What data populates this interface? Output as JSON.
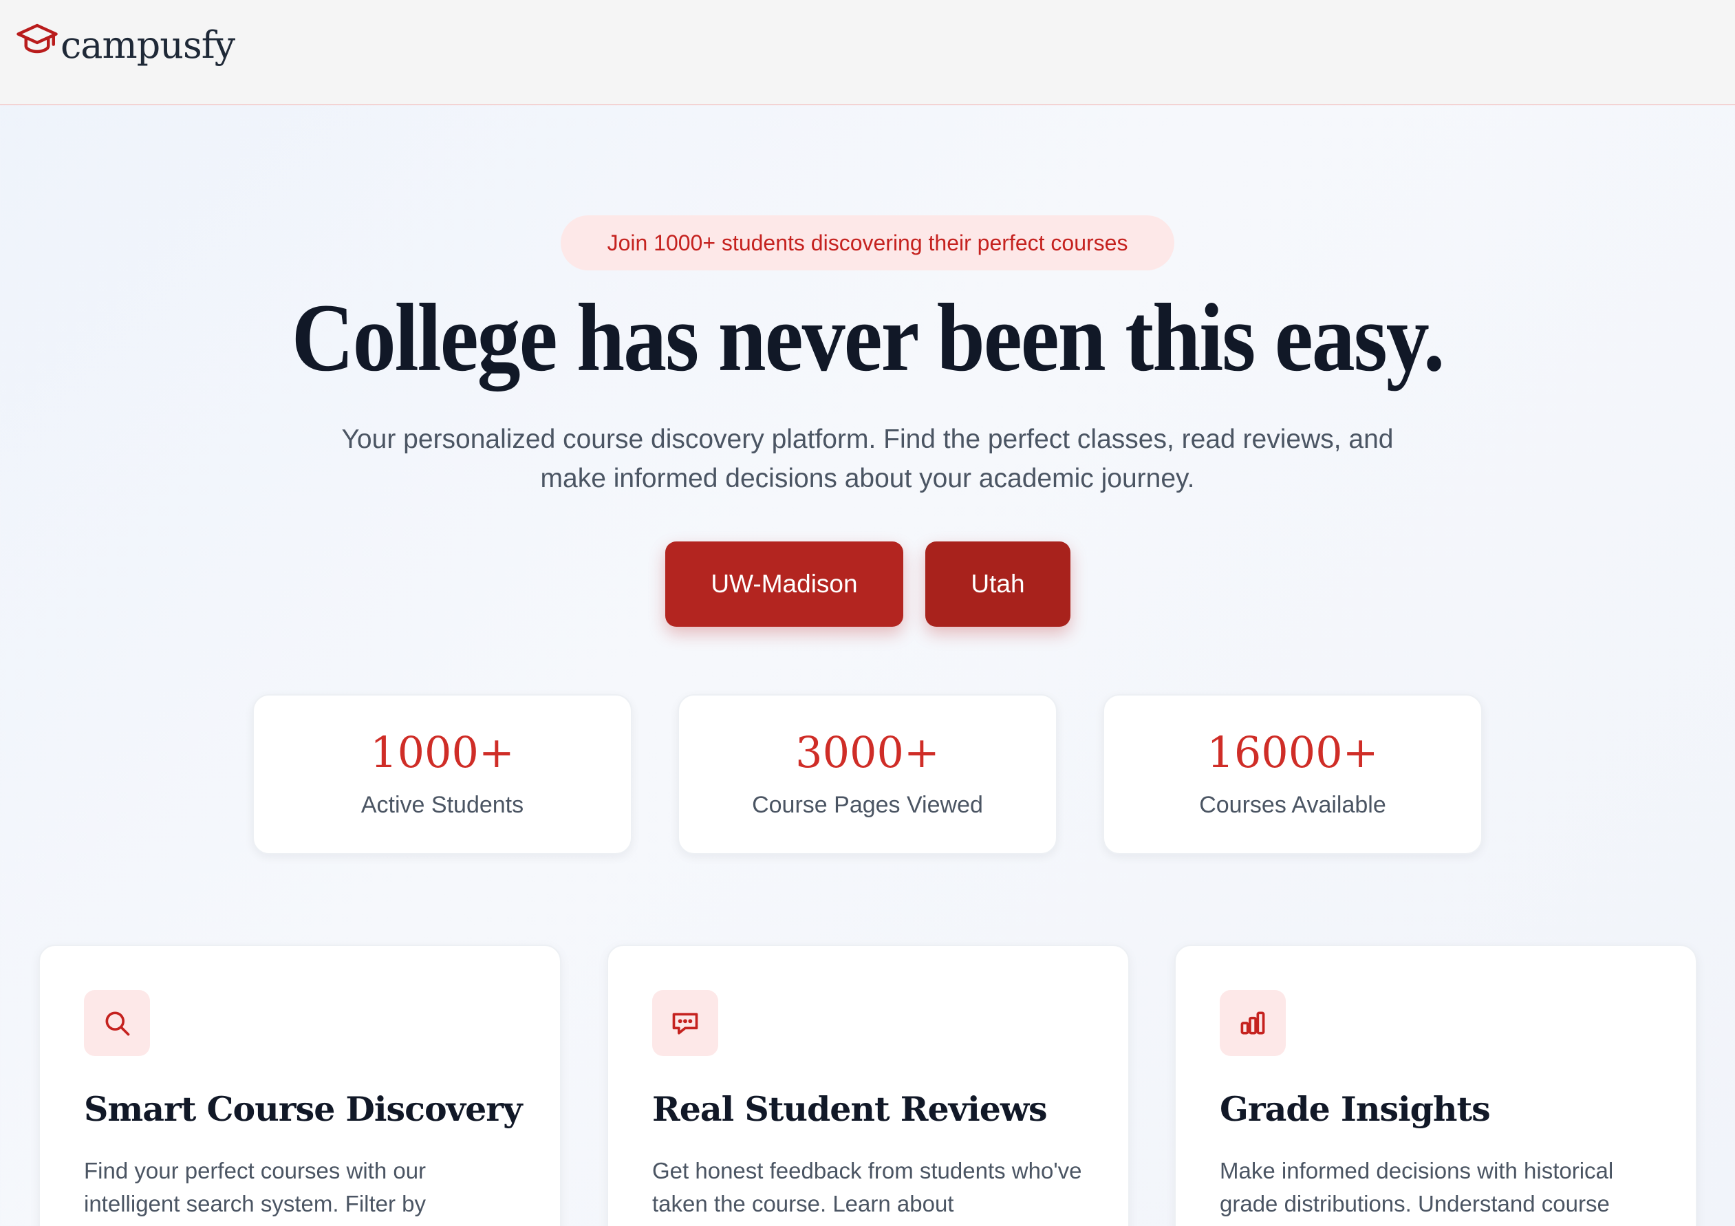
{
  "brand": {
    "name": "campusfy",
    "icon": "graduation-cap-icon",
    "accent_color": "#b91c1c"
  },
  "hero": {
    "badge": "Join 1000+ students discovering their perfect courses",
    "title": "College has never been this easy.",
    "subtitle": "Your personalized course discovery platform. Find the perfect classes, read reviews, and make informed decisions about your academic journey.",
    "buttons": [
      {
        "label": "UW-Madison"
      },
      {
        "label": "Utah"
      }
    ]
  },
  "stats": [
    {
      "value": "1000+",
      "label": "Active Students"
    },
    {
      "value": "3000+",
      "label": "Course Pages Viewed"
    },
    {
      "value": "16000+",
      "label": "Courses Available"
    }
  ],
  "features": [
    {
      "icon": "search-icon",
      "title": "Smart Course Discovery",
      "description": "Find your perfect courses with our intelligent search system. Filter by"
    },
    {
      "icon": "chat-bubble-icon",
      "title": "Real Student Reviews",
      "description": "Get honest feedback from students who've taken the course. Learn about"
    },
    {
      "icon": "bar-chart-icon",
      "title": "Grade Insights",
      "description": "Make informed decisions with historical grade distributions. Understand course"
    }
  ]
}
